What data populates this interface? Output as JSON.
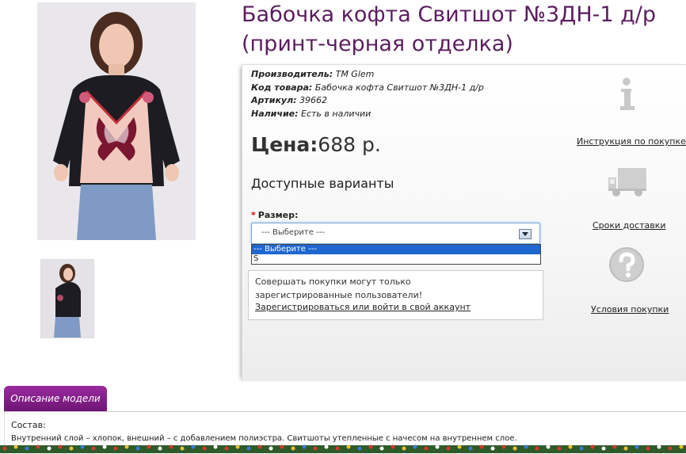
{
  "product": {
    "title": "Бабочка кофта Свитшот №3ДН-1 д/р (принт-черная отделка)",
    "manufacturer_label": "Производитель:",
    "manufacturer": "ТМ Glem",
    "code_label": "Код товара:",
    "code": "Бабочка кофта Свитшот №3ДН-1 д/р",
    "article_label": "Артикул:",
    "article": "39662",
    "availability_label": "Наличие:",
    "availability": "Есть в наличии",
    "price_label": "Цена:",
    "price_value": "688 р."
  },
  "options": {
    "heading": "Доступные варианты",
    "size_required_mark": "*",
    "size_label": "Размер:",
    "size_selected": "--- Выберите ---",
    "size_options": [
      "--- Выберите ---",
      "S"
    ]
  },
  "notice": {
    "text": "Совершать покупки могут только зарегистрированные пользователи!",
    "link": "Зарегистрироваться или войти в свой аккаунт"
  },
  "sidebar": {
    "instruction_link": "Инструкция по покупке",
    "delivery_link": "Сроки доставки",
    "terms_link": "Условия покупки"
  },
  "description": {
    "tab_label": "Описание модели",
    "heading": "Состав:",
    "text": "Внутренний слой – хлопок, внешний – с добавлением полиэстра. Свитшоты утепленные с начесом на внутреннем слое."
  },
  "colors": {
    "title": "#5b1d5f",
    "tab": "#8a2290",
    "select_highlight": "#1e66d0"
  }
}
